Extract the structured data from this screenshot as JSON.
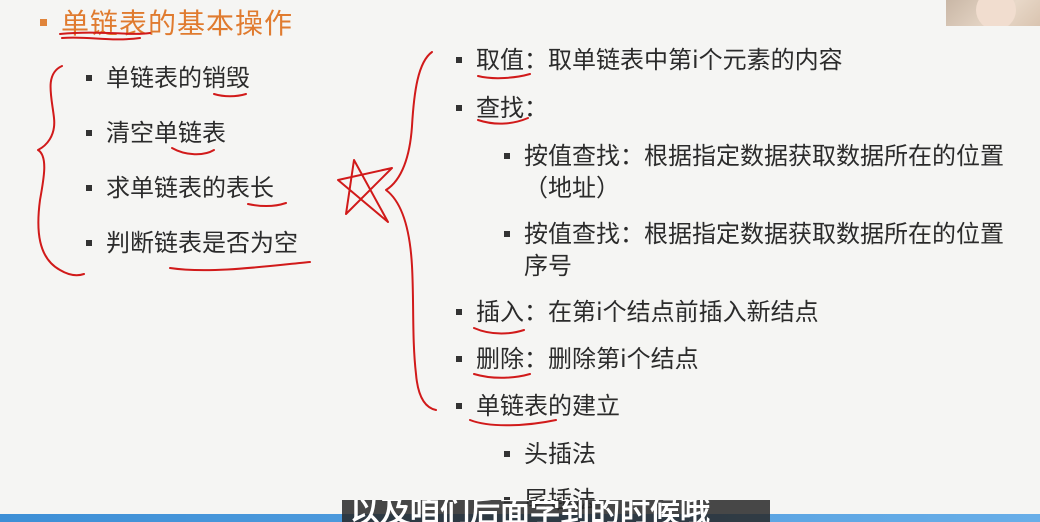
{
  "slide": {
    "title": "单链表的基本操作",
    "left_items": [
      "单链表的销毁",
      "清空单链表",
      "求单链表的表长",
      "判断链表是否为空"
    ],
    "right_items": [
      "取值：取单链表中第i个元素的内容",
      "查找：",
      "插入：在第i个结点前插入新结点",
      "删除：删除第i个结点",
      "单链表的建立"
    ],
    "find_sub_items": [
      "按值查找：根据指定数据获取数据所在的位置（地址）",
      "按值查找：根据指定数据获取数据所在的位置序号"
    ],
    "build_sub_items": [
      "头插法",
      "尾插法"
    ]
  },
  "subtitle": "以及咱们后面学到的时候哦",
  "colors": {
    "title": "#e07b2f",
    "ink": "#d11a1a",
    "bottom_bar": "#3d8fd6"
  }
}
